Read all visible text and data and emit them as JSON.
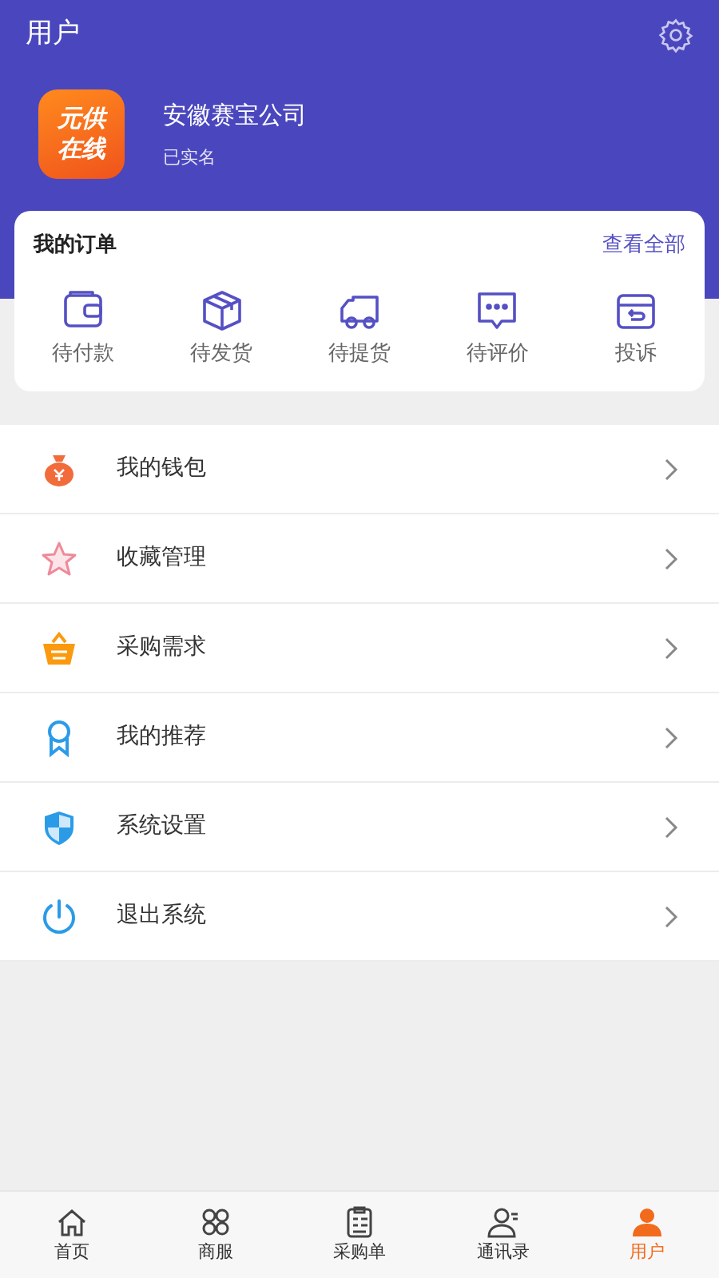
{
  "header": {
    "title": "用户"
  },
  "profile": {
    "logo_text": [
      "元供",
      "在线"
    ],
    "name": "安徽赛宝公司",
    "status": "已实名"
  },
  "orders": {
    "title": "我的订单",
    "view_all": "查看全部",
    "items": [
      {
        "kind": "wallet",
        "label": "待付款"
      },
      {
        "kind": "box",
        "label": "待发货"
      },
      {
        "kind": "truck",
        "label": "待提货"
      },
      {
        "kind": "chat",
        "label": "待评价"
      },
      {
        "kind": "return",
        "label": "投诉"
      }
    ]
  },
  "menu": [
    {
      "kind": "moneybag",
      "label": "我的钱包"
    },
    {
      "kind": "star",
      "label": "收藏管理"
    },
    {
      "kind": "basket",
      "label": "采购需求"
    },
    {
      "kind": "ribbon",
      "label": "我的推荐"
    },
    {
      "kind": "shield",
      "label": "系统设置"
    },
    {
      "kind": "power",
      "label": "退出系统"
    }
  ],
  "tab_bar": [
    {
      "kind": "home",
      "label": "首页",
      "selected": false
    },
    {
      "kind": "grid",
      "label": "商服",
      "selected": false
    },
    {
      "kind": "clipboard",
      "label": "采购单",
      "selected": false
    },
    {
      "kind": "contact",
      "label": "通讯录",
      "selected": false
    },
    {
      "kind": "user",
      "label": "用户",
      "selected": true
    }
  ]
}
